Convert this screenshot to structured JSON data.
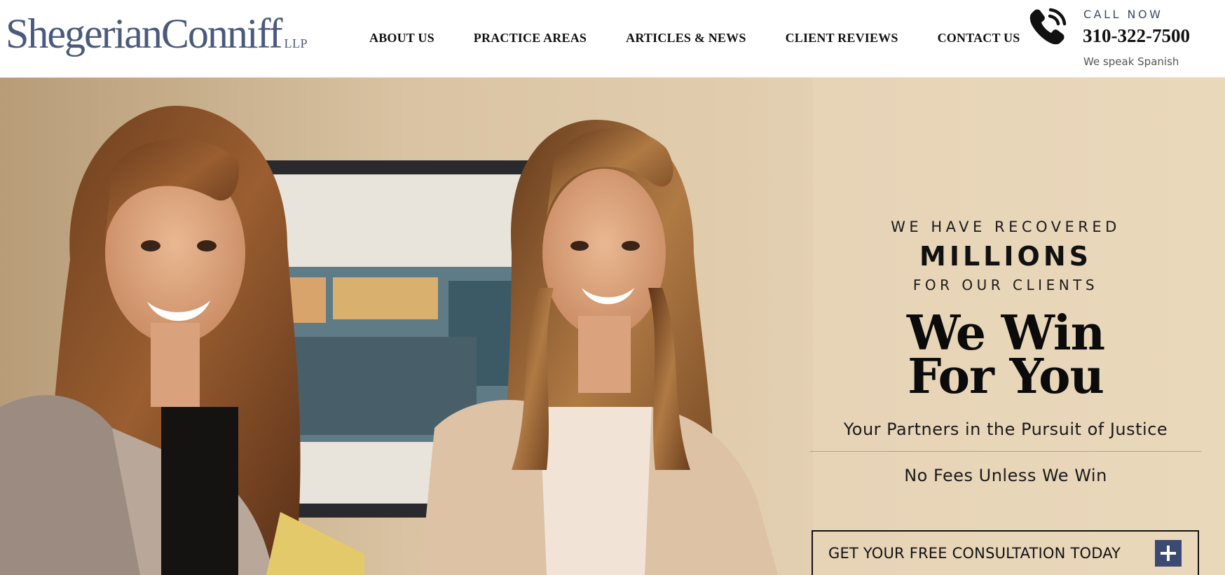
{
  "logo": {
    "main": "ShegerianConniff",
    "suffix": "LLP"
  },
  "nav": {
    "items": [
      {
        "label": "ABOUT US"
      },
      {
        "label": "PRACTICE AREAS"
      },
      {
        "label": "ARTICLES & NEWS"
      },
      {
        "label": "CLIENT REVIEWS"
      },
      {
        "label": "CONTACT US"
      }
    ]
  },
  "contact": {
    "call_label": "CALL NOW",
    "phone": "310-322-7500",
    "language_note": "We speak Spanish",
    "icon": "phone-icon"
  },
  "hero": {
    "recovered_line1": "WE HAVE RECOVERED",
    "recovered_amount": "MILLIONS",
    "recovered_line2": "FOR OUR CLIENTS",
    "headline_line1": "We Win",
    "headline_line2": "For You",
    "tagline": "Your Partners in the Pursuit of Justice",
    "fees_note": "No Fees Unless We Win",
    "cta_label": "GET YOUR FREE CONSULTATION TODAY",
    "cta_icon": "plus-icon",
    "photo_subject": "two-attorneys-photo"
  },
  "colors": {
    "brand_navy": "#4a5a7c",
    "cta_icon_bg": "#3a4a72",
    "hero_bg": "#e6d3b6"
  }
}
